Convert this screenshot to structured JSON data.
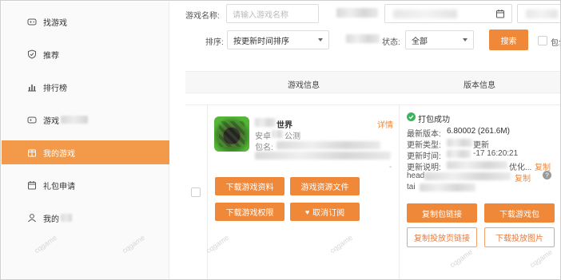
{
  "sidebar": {
    "items": [
      {
        "label": "找游戏",
        "icon": "gamepad-icon",
        "active": false
      },
      {
        "label": "推荐",
        "icon": "shield-icon",
        "active": false
      },
      {
        "label": "排行榜",
        "icon": "bar-chart-icon",
        "active": false
      },
      {
        "label": "游戏",
        "icon": "gamepad-icon",
        "active": false
      },
      {
        "label": "我的游戏",
        "icon": "gift-box-icon",
        "active": true
      },
      {
        "label": "礼包申请",
        "icon": "calendar-icon",
        "active": false
      },
      {
        "label": "我的",
        "icon": "user-icon",
        "active": false
      }
    ]
  },
  "filters": {
    "game_name_label": "游戏名称:",
    "game_name_placeholder": "请输入游戏名称",
    "sort_label": "排序:",
    "sort_value": "按更新时间排序",
    "status_label": "状态:",
    "status_value": "全部",
    "search_button": "搜索",
    "checkbox_label": "包含"
  },
  "table": {
    "headers": [
      "游戏信息",
      "版本信息"
    ],
    "row": {
      "game_title_suffix": "世界",
      "platform_prefix": "安卓",
      "publisher": "公测",
      "package_prefix": "包名:",
      "detail_link": "详情",
      "buttons": {
        "download_material": "下载游戏资料",
        "resource_files": "游戏资源文件",
        "download_permission": "下载游戏权限",
        "unsubscribe": "取消订阅"
      },
      "version": {
        "status": "打包成功",
        "latest_version_label": "最新版本:",
        "latest_version_value": "6.80002 (261.6M)",
        "update_type_label": "更新类型:",
        "update_type_value": "更新",
        "update_time_label": "更新时间:",
        "update_time_value": "-17 16:20:21",
        "update_desc_label": "更新说明:",
        "update_desc_value": "优化...",
        "copy_link_1": "复制",
        "head_prefix": "head",
        "copy_link_2": "复制",
        "tail_prefix": "tai",
        "copy_package_link": "复制包链接",
        "download_game_package": "下载游戏包",
        "copy_landing_link": "复制投放页链接",
        "download_ad_images": "下载投放图片"
      }
    }
  },
  "watermark_text": "cqgame",
  "colors": {
    "accent": "#f0883a",
    "active_sidebar": "#f39a4a",
    "success": "#3bb55a"
  }
}
